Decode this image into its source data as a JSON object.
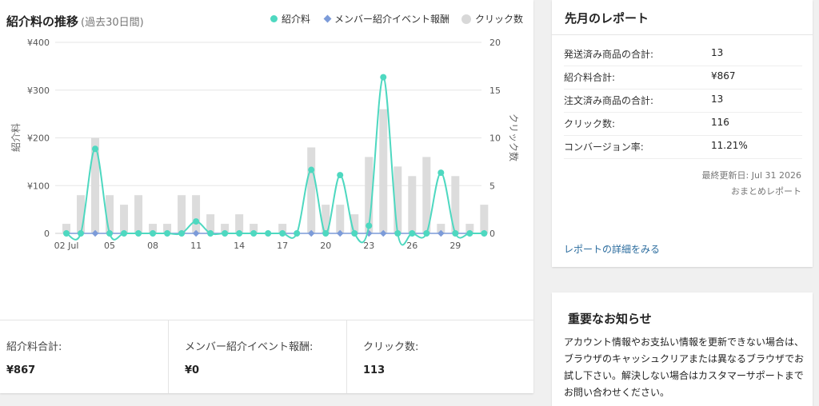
{
  "chart_panel": {
    "title": "紹介料の推移",
    "subtitle": "(過去30日間)",
    "legend": [
      {
        "label": "紹介料",
        "color": "#4ed8c0",
        "icon": "circle"
      },
      {
        "label": "メンバー紹介イベント報酬",
        "color": "#7c9bd9",
        "icon": "diamond"
      },
      {
        "label": "クリック数",
        "color": "#d8d8d8",
        "icon": "circle"
      }
    ],
    "left_axis_label": "紹介料",
    "right_axis_label": "クリック数"
  },
  "chart_data": {
    "type": "bar+line",
    "x": [
      "02 Jul",
      "03 Jul",
      "04 Jul",
      "05 Jul",
      "06 Jul",
      "07 Jul",
      "08 Jul",
      "09 Jul",
      "10 Jul",
      "11 Jul",
      "12 Jul",
      "13 Jul",
      "14 Jul",
      "15 Jul",
      "16 Jul",
      "17 Jul",
      "18 Jul",
      "19 Jul",
      "20 Jul",
      "21 Jul",
      "22 Jul",
      "23 Jul",
      "24 Jul",
      "25 Jul",
      "26 Jul",
      "27 Jul",
      "28 Jul",
      "29 Jul",
      "30 Jul",
      "31 Jul"
    ],
    "x_tick_labels": [
      "02 Jul",
      "05",
      "08",
      "11",
      "14",
      "17",
      "20",
      "23",
      "26",
      "29"
    ],
    "x_tick_indices": [
      0,
      3,
      6,
      9,
      12,
      15,
      18,
      21,
      24,
      27
    ],
    "y_left": {
      "label": "紹介料",
      "range": [
        0,
        400
      ],
      "ticks": [
        "0",
        "¥100",
        "¥200",
        "¥300",
        "¥400"
      ],
      "tick_values": [
        0,
        100,
        200,
        300,
        400
      ]
    },
    "y_right": {
      "label": "クリック数",
      "range": [
        0,
        20
      ],
      "ticks": [
        "0",
        "5",
        "10",
        "15",
        "20"
      ],
      "tick_values": [
        0,
        5,
        10,
        15,
        20
      ]
    },
    "grid": true,
    "legend_position": "top-right",
    "series": [
      {
        "name": "クリック数",
        "type": "bar",
        "axis": "right",
        "color": "#dcdcdc",
        "values": [
          1,
          4,
          10,
          4,
          3,
          4,
          1,
          1,
          4,
          4,
          2,
          1,
          2,
          1,
          0,
          1,
          0,
          9,
          3,
          3,
          2,
          8,
          13,
          7,
          6,
          8,
          1,
          6,
          1,
          3
        ]
      },
      {
        "name": "紹介料",
        "type": "line",
        "axis": "left",
        "color": "#4ed8c0",
        "values": [
          0,
          0,
          177,
          0,
          0,
          0,
          0,
          0,
          0,
          25,
          0,
          0,
          0,
          0,
          0,
          0,
          0,
          133,
          0,
          122,
          0,
          16,
          327,
          0,
          0,
          0,
          127,
          0,
          0,
          0
        ]
      },
      {
        "name": "メンバー紹介イベント報酬",
        "type": "line",
        "axis": "left",
        "color": "#7c9bd9",
        "values": [
          0,
          0,
          0,
          0,
          0,
          0,
          0,
          0,
          0,
          0,
          0,
          0,
          0,
          0,
          0,
          0,
          0,
          0,
          0,
          0,
          0,
          0,
          0,
          0,
          0,
          0,
          0,
          0,
          0,
          0
        ]
      }
    ]
  },
  "stats": [
    {
      "label": "紹介料合計:",
      "value": "¥867"
    },
    {
      "label": "メンバー紹介イベント報酬:",
      "value": "¥0"
    },
    {
      "label": "クリック数:",
      "value": "113"
    }
  ],
  "report": {
    "title": "先月のレポート",
    "rows": [
      {
        "label": "発送済み商品の合計:",
        "value": "13"
      },
      {
        "label": "紹介料合計:",
        "value": "¥867"
      },
      {
        "label": "注文済み商品の合計:",
        "value": "13"
      },
      {
        "label": "クリック数:",
        "value": "116"
      },
      {
        "label": "コンバージョン率:",
        "value": "11.21%"
      }
    ],
    "last_updated": "最終更新日: Jul 31 2026",
    "summary_note": "おまとめレポート",
    "detail_link": "レポートの詳細をみる"
  },
  "notice": {
    "title": "重要なお知らせ",
    "body": "アカウント情報やお支払い情報を更新できない場合は、ブラウザのキャッシュクリアまたは異なるブラウザでお試し下さい。解決しない場合はカスタマーサポートまでお問い合わせください。"
  }
}
